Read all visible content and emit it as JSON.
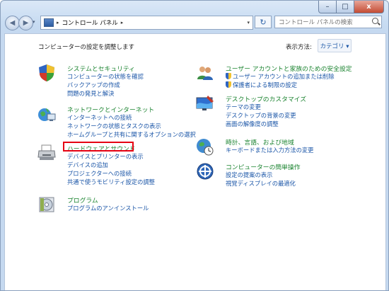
{
  "window": {
    "min": "–",
    "max": "□",
    "close": "x"
  },
  "address": {
    "breadcrumb": "コントロール パネル"
  },
  "search": {
    "placeholder": "コントロール パネルの検索"
  },
  "header": {
    "title": "コンピューターの設定を調整します",
    "view_by_label": "表示方法:",
    "view_by_value": "カテゴリ ▾"
  },
  "categories_left": [
    {
      "title": "システムとセキュリティ",
      "links": [
        "コンピューターの状態を確認",
        "バックアップの作成",
        "問題の発見と解決"
      ]
    },
    {
      "title": "ネットワークとインターネット",
      "links": [
        "インターネットへの接続",
        "ネットワークの状態とタスクの表示",
        "ホームグループと共有に関するオプションの選択"
      ]
    },
    {
      "title": "ハードウェアとサウンド",
      "links": [
        "デバイスとプリンターの表示",
        "デバイスの追加",
        "プロジェクターへの接続",
        "共通で使うモビリティ設定の調整"
      ]
    },
    {
      "title": "プログラム",
      "links": [
        "プログラムのアンインストール"
      ]
    }
  ],
  "categories_right": [
    {
      "title": "ユーザー アカウントと家族のための安全設定",
      "links": [
        "ユーザー アカウントの追加または削除",
        "保護者による制限の設定"
      ]
    },
    {
      "title": "デスクトップのカスタマイズ",
      "links": [
        "テーマの変更",
        "デスクトップの背景の変更",
        "画面の解像度の調整"
      ]
    },
    {
      "title": "時計、言語、および地域",
      "links": [
        "キーボードまたは入力方法の変更"
      ]
    },
    {
      "title": "コンピューターの簡単操作",
      "links": [
        "設定の提案の表示",
        "視覚ディスプレイの最適化"
      ]
    }
  ],
  "colors": {
    "category_title": "#1c8431",
    "link": "#1a55a7",
    "highlight": "#e60012"
  }
}
